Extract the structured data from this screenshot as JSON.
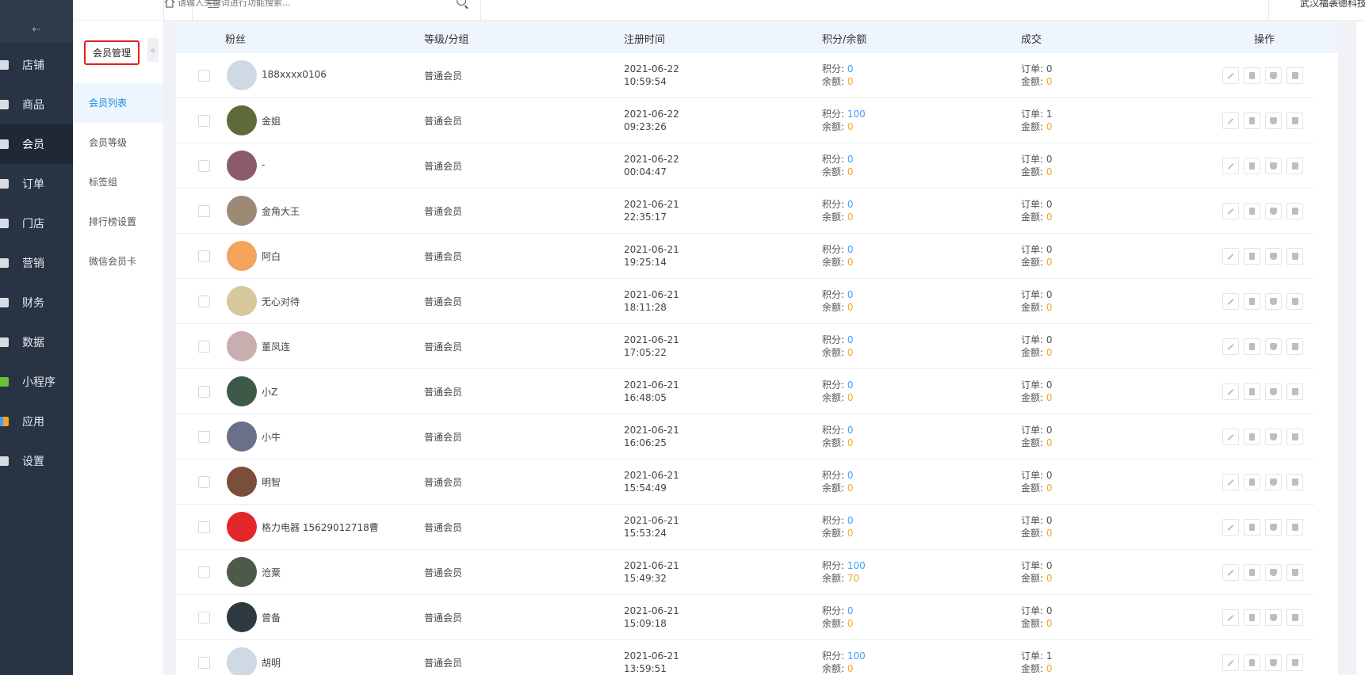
{
  "sidebar": {
    "items": [
      {
        "label": "店铺",
        "icon": "store-icon"
      },
      {
        "label": "商品",
        "icon": "goods-icon"
      },
      {
        "label": "会员",
        "icon": "user-icon",
        "active": true
      },
      {
        "label": "订单",
        "icon": "order-icon"
      },
      {
        "label": "门店",
        "icon": "shop-icon"
      },
      {
        "label": "营销",
        "icon": "gift-icon"
      },
      {
        "label": "财务",
        "icon": "money-icon"
      },
      {
        "label": "数据",
        "icon": "chart-icon"
      },
      {
        "label": "小程序",
        "icon": "miniprogram-icon"
      },
      {
        "label": "应用",
        "icon": "apps-icon"
      },
      {
        "label": "设置",
        "icon": "gear-icon"
      }
    ]
  },
  "submenu": {
    "title": "会员管理",
    "items": [
      {
        "label": "会员列表",
        "active": true
      },
      {
        "label": "会员等级"
      },
      {
        "label": "标签组"
      },
      {
        "label": "排行榜设置"
      },
      {
        "label": "微信会员卡"
      }
    ]
  },
  "topbar": {
    "search_placeholder": "请输入关键词进行功能搜索...",
    "company": "武汉福袭德科技"
  },
  "table": {
    "headers": {
      "fans": "粉丝",
      "level": "等级/分组",
      "time": "注册时间",
      "points": "积分/余额",
      "deal": "成交",
      "ops": "操作"
    },
    "labels": {
      "points": "积分: ",
      "balance": "余额: ",
      "orders": "订单: ",
      "amount": "金额: "
    },
    "rows": [
      {
        "nick": "188xxxx0106",
        "level": "普通会员",
        "date": "2021-06-22",
        "clock": "10:59:54",
        "points": "0",
        "balance": "0",
        "orders": "0",
        "amount": "0",
        "avatar_color": "#cfd8e3"
      },
      {
        "nick": "金姐",
        "level": "普通会员",
        "date": "2021-06-22",
        "clock": "09:23:26",
        "points": "100",
        "balance": "0",
        "orders": "1",
        "amount": "0",
        "avatar_color": "#5d6b3a"
      },
      {
        "nick": "-",
        "level": "普通会员",
        "date": "2021-06-22",
        "clock": "00:04:47",
        "points": "0",
        "balance": "0",
        "orders": "0",
        "amount": "0",
        "avatar_color": "#8a5a6a"
      },
      {
        "nick": "金角大王",
        "level": "普通会员",
        "date": "2021-06-21",
        "clock": "22:35:17",
        "points": "0",
        "balance": "0",
        "orders": "0",
        "amount": "0",
        "avatar_color": "#9c8a76"
      },
      {
        "nick": "阿白",
        "level": "普通会员",
        "date": "2021-06-21",
        "clock": "19:25:14",
        "points": "0",
        "balance": "0",
        "orders": "0",
        "amount": "0",
        "avatar_color": "#f3a35b"
      },
      {
        "nick": "无心对待",
        "level": "普通会员",
        "date": "2021-06-21",
        "clock": "18:11:28",
        "points": "0",
        "balance": "0",
        "orders": "0",
        "amount": "0",
        "avatar_color": "#d8c79a"
      },
      {
        "nick": "董凤连",
        "level": "普通会员",
        "date": "2021-06-21",
        "clock": "17:05:22",
        "points": "0",
        "balance": "0",
        "orders": "0",
        "amount": "0",
        "avatar_color": "#c9aeb0"
      },
      {
        "nick": "小Z",
        "level": "普通会员",
        "date": "2021-06-21",
        "clock": "16:48:05",
        "points": "0",
        "balance": "0",
        "orders": "0",
        "amount": "0",
        "avatar_color": "#3d5a48"
      },
      {
        "nick": "小牛",
        "level": "普通会员",
        "date": "2021-06-21",
        "clock": "16:06:25",
        "points": "0",
        "balance": "0",
        "orders": "0",
        "amount": "0",
        "avatar_color": "#6a708a"
      },
      {
        "nick": "明智",
        "level": "普通会员",
        "date": "2021-06-21",
        "clock": "15:54:49",
        "points": "0",
        "balance": "0",
        "orders": "0",
        "amount": "0",
        "avatar_color": "#7a4e3a"
      },
      {
        "nick": "格力电器 15629012718曹",
        "level": "普通会员",
        "date": "2021-06-21",
        "clock": "15:53:24",
        "points": "0",
        "balance": "0",
        "orders": "0",
        "amount": "0",
        "avatar_color": "#e3262a"
      },
      {
        "nick": "沧粟",
        "level": "普通会员",
        "date": "2021-06-21",
        "clock": "15:49:32",
        "points": "100",
        "balance": "70",
        "orders": "0",
        "amount": "0",
        "avatar_color": "#4d5a4a"
      },
      {
        "nick": "曾备",
        "level": "普通会员",
        "date": "2021-06-21",
        "clock": "15:09:18",
        "points": "0",
        "balance": "0",
        "orders": "0",
        "amount": "0",
        "avatar_color": "#2f3a40"
      },
      {
        "nick": "胡明",
        "level": "普通会员",
        "date": "2021-06-21",
        "clock": "13:59:51",
        "points": "100",
        "balance": "0",
        "orders": "1",
        "amount": "0",
        "avatar_color": "#cfd8e3"
      }
    ]
  }
}
